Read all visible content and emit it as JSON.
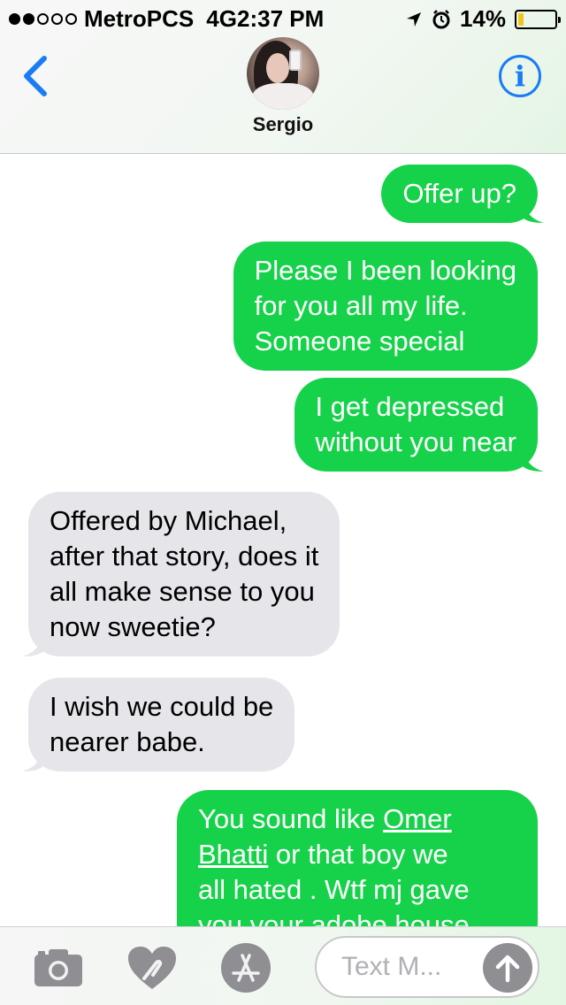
{
  "status_bar": {
    "carrier": "MetroPCS",
    "network": "4G",
    "time": "2:37 PM",
    "battery": "14%",
    "battery_level": 0.14,
    "signal_bars_filled": 2,
    "signal_bars_total": 5
  },
  "header": {
    "contact_name": "Sergio",
    "back_icon": "chevron-left-icon",
    "info_icon": "info-icon",
    "info_glyph": "i"
  },
  "messages": [
    {
      "direction": "outgoing",
      "lines": [
        "Offer up?"
      ]
    },
    {
      "direction": "outgoing",
      "lines": [
        "Please I been looking",
        "for you all my life.",
        "Someone special"
      ]
    },
    {
      "direction": "outgoing",
      "lines": [
        "I get depressed",
        "without you near"
      ]
    },
    {
      "direction": "incoming",
      "lines": [
        "Offered by Michael,",
        "after that story, does it",
        "all make sense to you",
        "now sweetie?"
      ]
    },
    {
      "direction": "incoming",
      "lines": [
        "I wish we could be",
        "nearer babe."
      ]
    },
    {
      "direction": "outgoing",
      "lines": [
        "You sound like ",
        "Omer",
        "Bhatti",
        " or that boy we",
        "all hated . Wtf mj gave",
        "you your adobe house"
      ]
    }
  ],
  "input_bar": {
    "placeholder": "Text M...",
    "camera_icon": "camera-icon",
    "digital_touch_icon": "heart-touch-icon",
    "app_store_icon": "app-store-icon",
    "send_icon": "arrow-up-icon"
  },
  "colors": {
    "outgoing_bubble": "#16d24a",
    "incoming_bubble": "#e5e5ea",
    "accent_blue": "#1a7cf5",
    "battery_fill": "#f3c41b"
  }
}
